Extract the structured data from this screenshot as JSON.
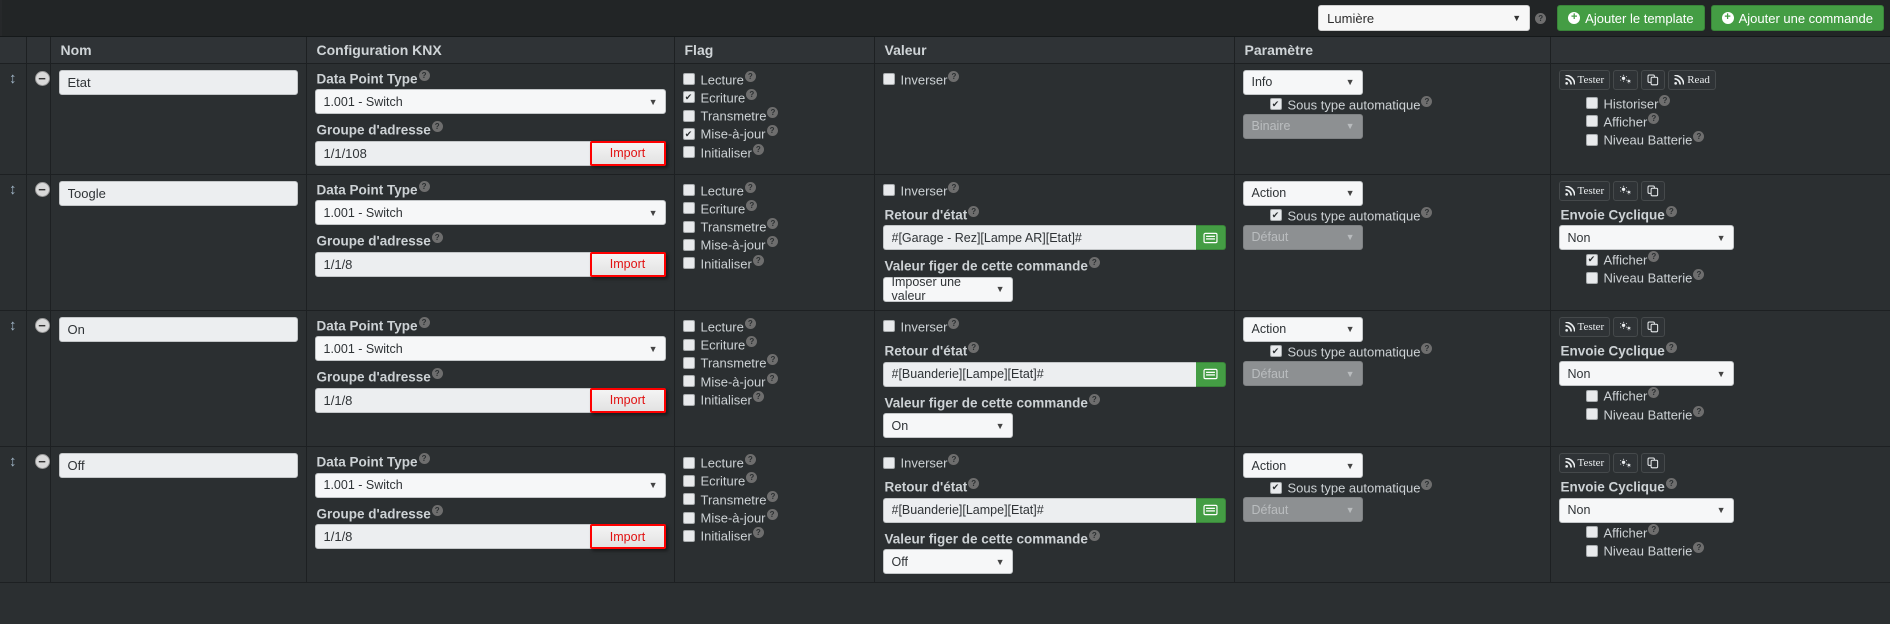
{
  "topbar": {
    "template_select": {
      "value": "Lumière",
      "caret": "▼"
    },
    "help_symbol": "?",
    "add_template_button": "Ajouter le template",
    "add_command_button": "Ajouter une commande",
    "plus_symbol": "+"
  },
  "columns": {
    "handle": "",
    "minus": "",
    "nom": "Nom",
    "knx": "Configuration KNX",
    "flag": "Flag",
    "valeur": "Valeur",
    "parametre": "Paramètre",
    "actions": ""
  },
  "labels": {
    "data_point_type": "Data Point Type",
    "groupe_adresse": "Groupe d'adresse",
    "retour_etat": "Retour d'état",
    "valeur_figer": "Valeur figer de cette commande",
    "envoie_cyclique": "Envoie Cyclique",
    "sous_type_auto": "Sous type automatique",
    "inverser": "Inverser",
    "import": "Import",
    "help": "?",
    "caret": "▼",
    "drag_handle": "↕",
    "minus": "−"
  },
  "flag_labels": {
    "lecture": "Lecture",
    "ecriture": "Ecriture",
    "transmetre": "Transmetre",
    "mise_a_jour": "Mise-à-jour",
    "initialiser": "Initialiser"
  },
  "action_labels": {
    "tester": "Tester",
    "read": "Read",
    "historiser": "Historiser",
    "afficher": "Afficher",
    "niveau_batterie": "Niveau Batterie"
  },
  "colors": {
    "accent_green": "#449d44",
    "import_red": "#fe0000",
    "panel_bg": "#2b2f31",
    "header_bg": "#2f3336"
  },
  "rows": [
    {
      "nom": "Etat",
      "dpt": "1.001 - Switch",
      "adresse": "1/1/108",
      "flags": {
        "lecture": false,
        "ecriture": true,
        "transmetre": false,
        "mise_a_jour": true,
        "initialiser": false
      },
      "inverser": false,
      "has_retour_etat": false,
      "retour_etat": "",
      "valeur_figer": "",
      "param_type": "Info",
      "sous_type_auto": true,
      "sous_type": "Binaire",
      "has_read": true,
      "has_historiser": true,
      "has_envoie_cyclique": false,
      "envoie_cyclique": "",
      "historiser": false,
      "afficher": false,
      "niveau_batterie": false
    },
    {
      "nom": "Toogle",
      "dpt": "1.001 - Switch",
      "adresse": "1/1/8",
      "flags": {
        "lecture": false,
        "ecriture": false,
        "transmetre": false,
        "mise_a_jour": false,
        "initialiser": false
      },
      "inverser": false,
      "has_retour_etat": true,
      "retour_etat": "#[Garage - Rez][Lampe AR][Etat]#",
      "valeur_figer": "Imposer une valeur",
      "param_type": "Action",
      "sous_type_auto": true,
      "sous_type": "Défaut",
      "has_read": false,
      "has_historiser": false,
      "has_envoie_cyclique": true,
      "envoie_cyclique": "Non",
      "historiser": false,
      "afficher": true,
      "niveau_batterie": false
    },
    {
      "nom": "On",
      "dpt": "1.001 - Switch",
      "adresse": "1/1/8",
      "flags": {
        "lecture": false,
        "ecriture": false,
        "transmetre": false,
        "mise_a_jour": false,
        "initialiser": false
      },
      "inverser": false,
      "has_retour_etat": true,
      "retour_etat": "#[Buanderie][Lampe][Etat]#",
      "valeur_figer": "On",
      "param_type": "Action",
      "sous_type_auto": true,
      "sous_type": "Défaut",
      "has_read": false,
      "has_historiser": false,
      "has_envoie_cyclique": true,
      "envoie_cyclique": "Non",
      "historiser": false,
      "afficher": false,
      "niveau_batterie": false
    },
    {
      "nom": "Off",
      "dpt": "1.001 - Switch",
      "adresse": "1/1/8",
      "flags": {
        "lecture": false,
        "ecriture": false,
        "transmetre": false,
        "mise_a_jour": false,
        "initialiser": false
      },
      "inverser": false,
      "has_retour_etat": true,
      "retour_etat": "#[Buanderie][Lampe][Etat]#",
      "valeur_figer": "Off",
      "param_type": "Action",
      "sous_type_auto": true,
      "sous_type": "Défaut",
      "has_read": false,
      "has_historiser": false,
      "has_envoie_cyclique": true,
      "envoie_cyclique": "Non",
      "historiser": false,
      "afficher": false,
      "niveau_batterie": false
    }
  ]
}
